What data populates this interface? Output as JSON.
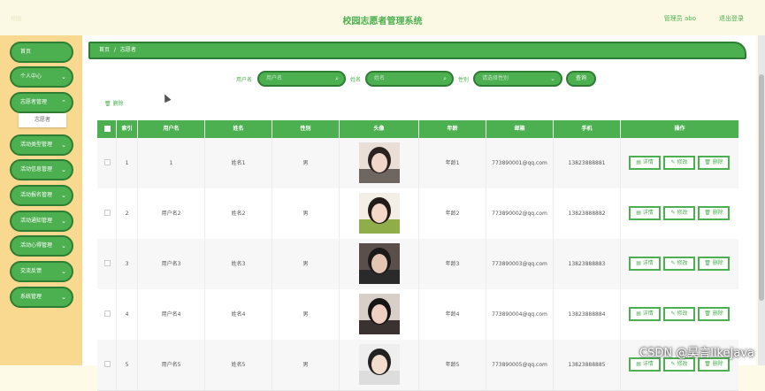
{
  "header": {
    "top_left": "校园",
    "title": "校园志愿者管理系统",
    "admin_label": "管理员 abo",
    "logout_label": "退出登录"
  },
  "sidebar": {
    "items": [
      {
        "label": "首页",
        "chevron": false
      },
      {
        "label": "个人中心",
        "chevron": true
      },
      {
        "label": "志愿者管理",
        "chevron": true
      },
      {
        "label": "活动类型管理",
        "chevron": true
      },
      {
        "label": "活动信息管理",
        "chevron": true
      },
      {
        "label": "活动报名管理",
        "chevron": true
      },
      {
        "label": "活动通知管理",
        "chevron": true
      },
      {
        "label": "活动心得管理",
        "chevron": true
      },
      {
        "label": "交流反馈",
        "chevron": true
      },
      {
        "label": "系统管理",
        "chevron": true
      }
    ],
    "sub_item": "志愿者"
  },
  "breadcrumb": {
    "home": "首页",
    "separator": "/",
    "current": "志愿者"
  },
  "search": {
    "username_label": "用户名",
    "username_placeholder": "用户名",
    "name_label": "姓名",
    "name_placeholder": "姓名",
    "gender_label": "性别",
    "gender_placeholder": "请选择性别",
    "search_button": "查询"
  },
  "toolbar": {
    "delete_label": "删除"
  },
  "table": {
    "columns": [
      "索引",
      "用户名",
      "姓名",
      "性别",
      "头像",
      "年龄",
      "邮箱",
      "手机",
      "操作"
    ],
    "rows": [
      {
        "index": "1",
        "username": "1",
        "name": "姓名1",
        "gender": "男",
        "age": "年龄1",
        "email": "773890001@qq.com",
        "phone": "13823888881"
      },
      {
        "index": "2",
        "username": "用户名2",
        "name": "姓名2",
        "gender": "男",
        "age": "年龄2",
        "email": "773890002@qq.com",
        "phone": "13823888882"
      },
      {
        "index": "3",
        "username": "用户名3",
        "name": "姓名3",
        "gender": "男",
        "age": "年龄3",
        "email": "773890003@qq.com",
        "phone": "13823888883"
      },
      {
        "index": "4",
        "username": "用户名4",
        "name": "姓名4",
        "gender": "男",
        "age": "年龄4",
        "email": "773890004@qq.com",
        "phone": "13823888884"
      },
      {
        "index": "5",
        "username": "用户名5",
        "name": "姓名5",
        "gender": "男",
        "age": "年龄5",
        "email": "773890005@qq.com",
        "phone": "13823888885"
      }
    ],
    "actions": {
      "detail": "详情",
      "edit": "修改",
      "delete": "删除"
    }
  },
  "watermark": "CSDN @昊言likeJava",
  "colors": {
    "accent": "#4caf50",
    "accent_dark": "#2e7d32",
    "sidebar_bg": "#f9d98f",
    "top_bg": "#fbf9e3"
  }
}
